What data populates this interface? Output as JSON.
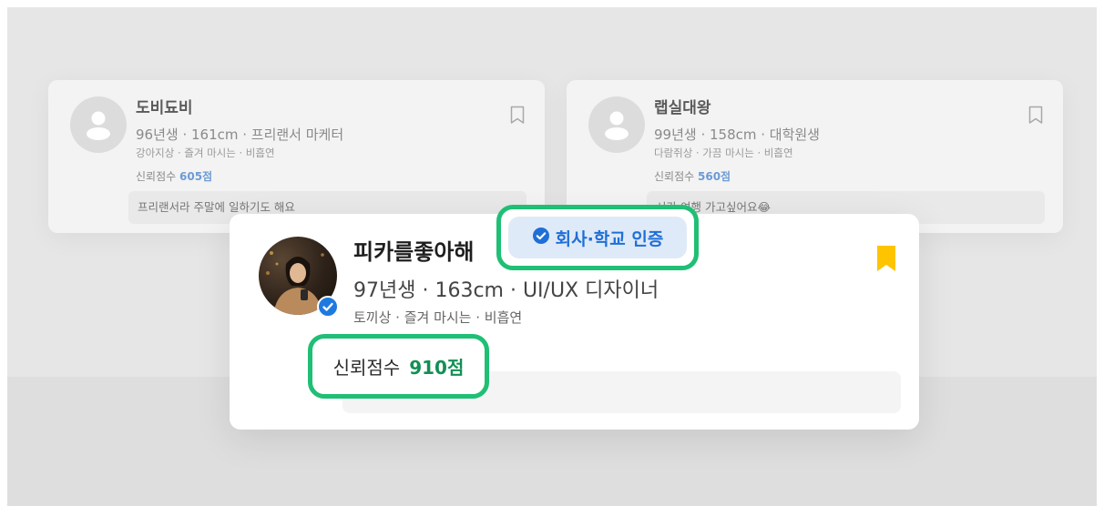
{
  "profiles": [
    {
      "name": "도비됴비",
      "meta": "96년생 · 161cm · 프리랜서 마케터",
      "tags": "강아지상 · 즐겨 마시는 · 비흡연",
      "trust_label": "신뢰점수",
      "trust_score": "605점",
      "intro": "프리랜서라 주말에 일하기도 해요"
    },
    {
      "name": "랩실대왕",
      "meta": "99년생 · 158cm · 대학원생",
      "tags": "다람쥐상 · 가끔 마시는 · 비흡연",
      "trust_label": "신뢰점수",
      "trust_score": "560점",
      "intro": "시간 여행 가고싶어요😂"
    }
  ],
  "featured": {
    "name": "피카를좋아해",
    "meta": "97년생 · 163cm · UI/UX 디자이너",
    "tags": "토끼상 · 즐겨 마시는 · 비흡연",
    "certification": "회사·학교 인증",
    "trust_label": "신뢰점수",
    "trust_score": "910점"
  },
  "icons": [
    "bookmark-outline-icon",
    "bookmark-filled-icon",
    "check-circle-icon",
    "verified-check-icon",
    "person-placeholder-icon"
  ],
  "colors": {
    "highlight_border": "#1fbf75",
    "cert_text": "#1f6fd6",
    "cert_bg": "#dfeaf8",
    "trust_score": "#138f55",
    "bookmark_active": "#ffc400",
    "verified_badge": "#1f7ae0"
  }
}
